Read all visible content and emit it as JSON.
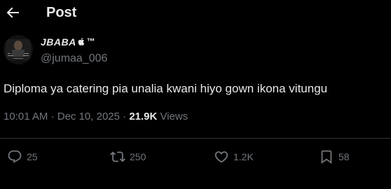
{
  "header": {
    "title": "Post",
    "back_icon": "back-arrow-icon"
  },
  "author": {
    "display_name": "JBABA™",
    "display_name_shown": "JBABA",
    "display_name_suffix": "™",
    "handle": "@jumaa_006",
    "avatar_icon": "avatar"
  },
  "tweet": {
    "text": "Diploma ya catering pia unalia kwani hiyo gown ikona vitungu"
  },
  "meta": {
    "time": "10:01 AM",
    "separator": "·",
    "date": "Dec 10, 2025",
    "views_count": "21.9K",
    "views_label": "Views"
  },
  "actions": {
    "replies": "25",
    "reposts": "250",
    "likes": "1.2K",
    "bookmarks": "58"
  },
  "colors": {
    "background": "#000000",
    "primary_text": "#e7e9ea",
    "secondary_text": "#71767b",
    "divider": "#2f3336"
  }
}
